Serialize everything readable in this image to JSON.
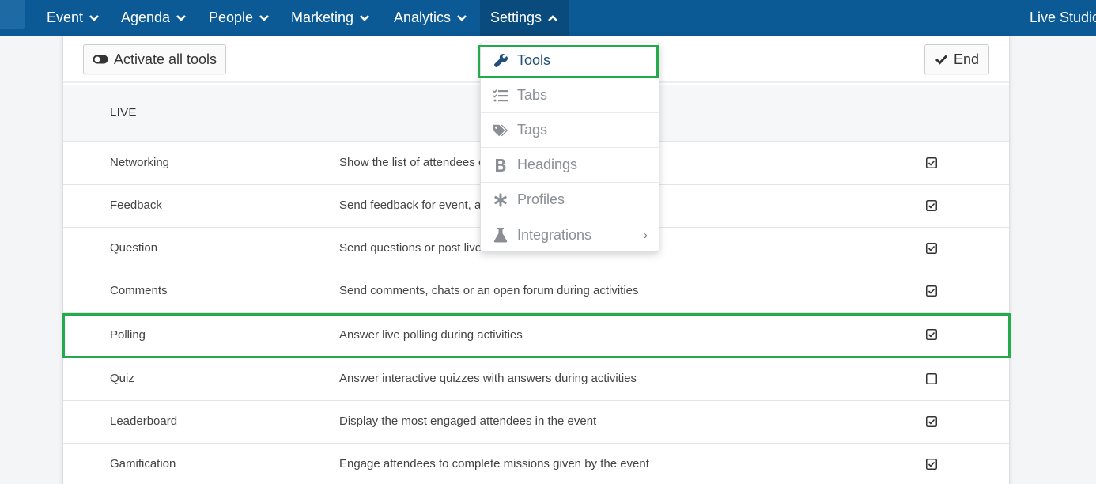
{
  "nav": {
    "items": [
      {
        "label": "Event"
      },
      {
        "label": "Agenda"
      },
      {
        "label": "People"
      },
      {
        "label": "Marketing"
      },
      {
        "label": "Analytics"
      },
      {
        "label": "Settings"
      }
    ],
    "right_label": "Live Studio",
    "active_item": "Settings"
  },
  "toolbar": {
    "activate_label": "Activate all tools",
    "end_label": "End"
  },
  "section": {
    "title": "LIVE"
  },
  "rows": [
    {
      "name": "Networking",
      "desc": "Show the list of attendees o",
      "checked": true
    },
    {
      "name": "Feedback",
      "desc": "Send feedback for event, ac",
      "checked": true
    },
    {
      "name": "Question",
      "desc": "Send questions or post live",
      "checked": true
    },
    {
      "name": "Comments",
      "desc": "Send comments, chats or an open forum during activities",
      "checked": true
    },
    {
      "name": "Polling",
      "desc": "Answer live polling during activities",
      "checked": true
    },
    {
      "name": "Quiz",
      "desc": "Answer interactive quizzes with answers during activities",
      "checked": false
    },
    {
      "name": "Leaderboard",
      "desc": "Display the most engaged attendees in the event",
      "checked": true
    },
    {
      "name": "Gamification",
      "desc": "Engage attendees to complete missions given by the event",
      "checked": true
    }
  ],
  "settings_menu": {
    "items": [
      {
        "label": "Tools",
        "icon": "wrench-icon"
      },
      {
        "label": "Tabs",
        "icon": "checklist-icon"
      },
      {
        "label": "Tags",
        "icon": "tags-icon"
      },
      {
        "label": "Headings",
        "icon": "bold-icon"
      },
      {
        "label": "Profiles",
        "icon": "asterisk-icon"
      },
      {
        "label": "Integrations",
        "icon": "flask-icon"
      }
    ],
    "active_item": "Tools"
  },
  "colors": {
    "nav_bg": "#0b5a95",
    "highlight": "#24a94c",
    "menu_active_text": "#1f4f7a"
  }
}
